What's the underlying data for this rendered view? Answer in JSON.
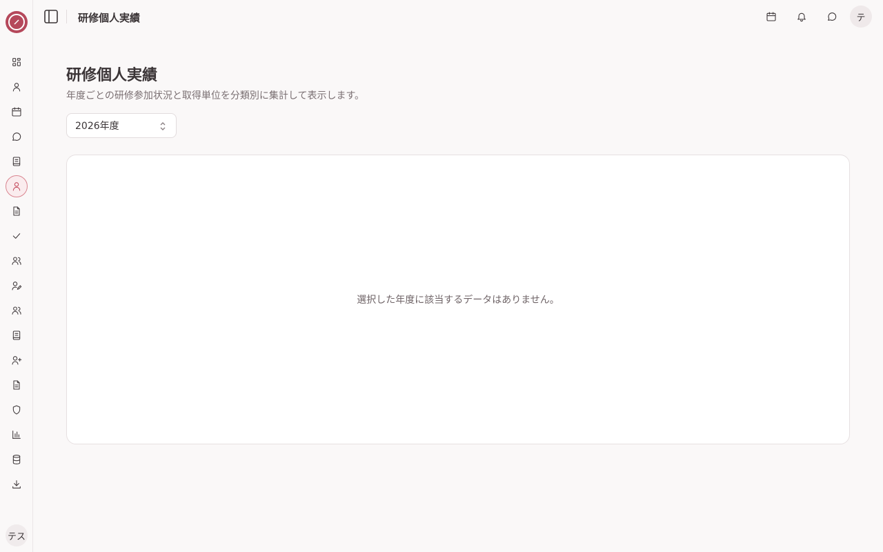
{
  "app": {
    "page_title": "研修個人実績",
    "brand_color": "#b5485b"
  },
  "sidebar": {
    "items": [
      {
        "icon": "dashboard-icon",
        "active": false
      },
      {
        "icon": "user-icon",
        "active": false
      },
      {
        "icon": "calendar-icon",
        "active": false
      },
      {
        "icon": "chat-icon",
        "active": false
      },
      {
        "icon": "book-icon",
        "active": false
      },
      {
        "icon": "user-icon",
        "active": true
      },
      {
        "icon": "file-text-icon",
        "active": false
      },
      {
        "icon": "check-icon",
        "active": false
      },
      {
        "icon": "users-icon",
        "active": false
      },
      {
        "icon": "user-pen-icon",
        "active": false
      },
      {
        "icon": "users-icon",
        "active": false
      },
      {
        "icon": "book-icon",
        "active": false
      },
      {
        "icon": "user-plus-icon",
        "active": false
      },
      {
        "icon": "file-text-icon",
        "active": false
      },
      {
        "icon": "shield-icon",
        "active": false
      },
      {
        "icon": "bar-chart-icon",
        "active": false
      },
      {
        "icon": "database-icon",
        "active": false
      },
      {
        "icon": "download-icon",
        "active": false
      }
    ],
    "user_avatar": "テス"
  },
  "header": {
    "title": "研修個人実績",
    "avatar": "テ",
    "icons": [
      "calendar-icon",
      "bell-icon",
      "chat-icon"
    ]
  },
  "main": {
    "heading": "研修個人実績",
    "description": "年度ごとの研修参加状況と取得単位を分類別に集計して表示します。",
    "year_select": {
      "value": "2026年度"
    },
    "empty_message": "選択した年度に該当するデータはありません。"
  }
}
